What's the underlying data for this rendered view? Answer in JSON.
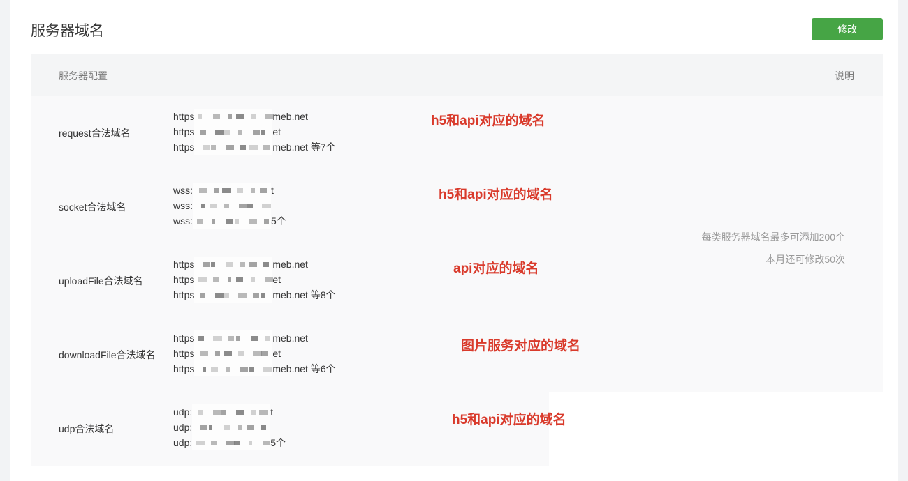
{
  "title": "服务器域名",
  "edit_button": "修改",
  "table": {
    "col_config": "服务器配置",
    "col_desc": "说明"
  },
  "rows": [
    {
      "label": "request合法域名",
      "lines": [
        {
          "prefix": "https",
          "suffix": "meb.net"
        },
        {
          "prefix": "https",
          "suffix": "et"
        },
        {
          "prefix": "https",
          "suffix": "meb.net 等7个"
        }
      ],
      "note": "h5和api对应的域名"
    },
    {
      "label": "socket合法域名",
      "lines": [
        {
          "prefix": "wss:",
          "suffix": "t"
        },
        {
          "prefix": "wss:",
          "suffix": ""
        },
        {
          "prefix": "wss:",
          "suffix": "5个"
        }
      ],
      "note": "h5和api对应的域名"
    },
    {
      "label": "uploadFile合法域名",
      "lines": [
        {
          "prefix": "https",
          "suffix": "meb.net"
        },
        {
          "prefix": "https",
          "suffix": "et"
        },
        {
          "prefix": "https",
          "suffix": "meb.net 等8个"
        }
      ],
      "note": "api对应的域名"
    },
    {
      "label": "downloadFile合法域名",
      "lines": [
        {
          "prefix": "https",
          "suffix": "meb.net"
        },
        {
          "prefix": "https",
          "suffix": "et"
        },
        {
          "prefix": "https",
          "suffix": "meb.net 等6个"
        }
      ],
      "note": "图片服务对应的域名"
    },
    {
      "label": "udp合法域名",
      "lines": [
        {
          "prefix": "udp:",
          "suffix": "t"
        },
        {
          "prefix": "udp:",
          "suffix": ""
        },
        {
          "prefix": "udp:",
          "suffix": "5个"
        }
      ],
      "note": "h5和api对应的域名"
    }
  ],
  "tips": [
    "每类服务器域名最多可添加200个",
    "本月还可修改50次"
  ],
  "colors": {
    "accent": "#46a545",
    "annotation": "#d93a2b"
  }
}
